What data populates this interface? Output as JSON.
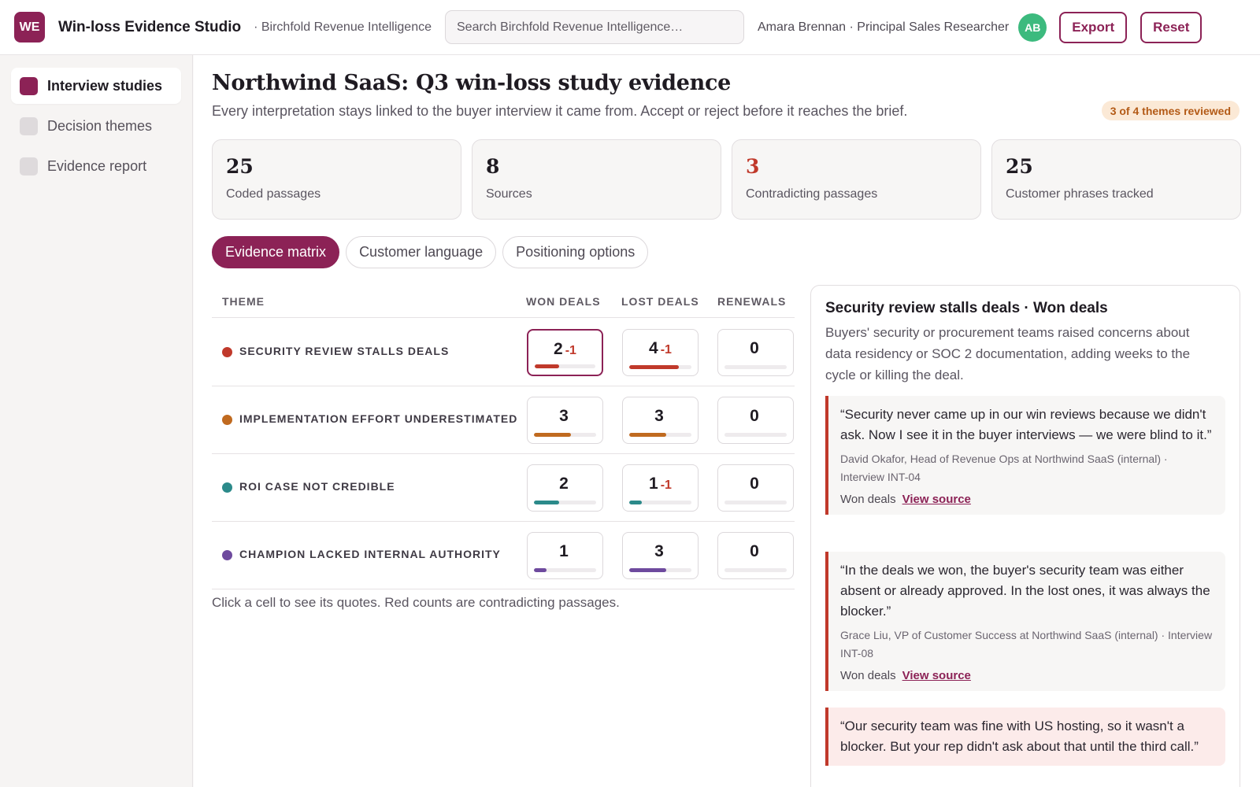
{
  "app": {
    "logo_text": "WE",
    "title": "Win-loss Evidence Studio",
    "org": "· Birchfold Revenue Intelligence",
    "search_placeholder": "Search Birchfold Revenue Intelligence…",
    "user": "Amara Brennan · Principal Sales Researcher",
    "avatar_initials": "AB",
    "export_label": "Export",
    "reset_label": "Reset",
    "accent_color": "#8c2256"
  },
  "sidebar": {
    "items": [
      {
        "label": "Interview studies",
        "active": true
      },
      {
        "label": "Decision themes",
        "active": false
      },
      {
        "label": "Evidence report",
        "active": false
      }
    ]
  },
  "page": {
    "title": "Northwind SaaS: Q3 win-loss study evidence",
    "subtitle": "Every interpretation stays linked to the buyer interview it came from. Accept or reject before it reaches the brief.",
    "review_badge": "3 of 4 themes reviewed"
  },
  "stats": [
    {
      "value": "25",
      "label": "Coded passages"
    },
    {
      "value": "8",
      "label": "Sources"
    },
    {
      "value": "3",
      "label": "Contradicting passages",
      "alert": true
    },
    {
      "value": "25",
      "label": "Customer phrases tracked"
    }
  ],
  "tabs": [
    {
      "label": "Evidence matrix",
      "active": true
    },
    {
      "label": "Customer language",
      "active": false
    },
    {
      "label": "Positioning options",
      "active": false
    }
  ],
  "matrix": {
    "headers": [
      "THEME",
      "WON DEALS",
      "LOST DEALS",
      "RENEWALS"
    ],
    "bar_max": 5,
    "rows": [
      {
        "theme": "SECURITY REVIEW STALLS DEALS",
        "color": "#c0392b",
        "cells": [
          {
            "count": "2",
            "delta": "-1",
            "bar": 2,
            "selected": true
          },
          {
            "count": "4",
            "delta": "-1",
            "bar": 4
          },
          {
            "count": "0",
            "delta": "",
            "bar": 0
          }
        ]
      },
      {
        "theme": "IMPLEMENTATION EFFORT UNDERESTIMATED",
        "color": "#c06a1f",
        "cells": [
          {
            "count": "3",
            "delta": "",
            "bar": 3
          },
          {
            "count": "3",
            "delta": "",
            "bar": 3
          },
          {
            "count": "0",
            "delta": "",
            "bar": 0
          }
        ]
      },
      {
        "theme": "ROI CASE NOT CREDIBLE",
        "color": "#2b8a8a",
        "cells": [
          {
            "count": "2",
            "delta": "",
            "bar": 2
          },
          {
            "count": "1",
            "delta": "-1",
            "bar": 1
          },
          {
            "count": "0",
            "delta": "",
            "bar": 0
          }
        ]
      },
      {
        "theme": "CHAMPION LACKED INTERNAL AUTHORITY",
        "color": "#6e4a9e",
        "cells": [
          {
            "count": "1",
            "delta": "",
            "bar": 1
          },
          {
            "count": "3",
            "delta": "",
            "bar": 3
          },
          {
            "count": "0",
            "delta": "",
            "bar": 0
          }
        ]
      }
    ],
    "note": "Click a cell to see its quotes. Red counts are contradicting passages."
  },
  "detail": {
    "title": "Security review stalls deals · Won deals",
    "description": "Buyers' security or procurement teams raised concerns about data residency or SOC 2 documentation, adding weeks to the cycle or killing the deal.",
    "quotes": [
      {
        "text": "“Security never came up in our win reviews because we didn't ask. Now I see it in the buyer interviews — we were blind to it.”",
        "attribution": "David Okafor, Head of Revenue Ops at Northwind SaaS (internal) · Interview INT-04",
        "tag": "Won deals",
        "link": "View source",
        "highlight": false
      },
      {
        "text": "“In the deals we won, the buyer's security team was either absent or already approved. In the lost ones, it was always the blocker.”",
        "attribution": "Grace Liu, VP of Customer Success at Northwind SaaS (internal) · Interview INT-08",
        "tag": "Won deals",
        "link": "View source",
        "highlight": false
      },
      {
        "text": "“Our security team was fine with US hosting, so it wasn't a blocker. But your rep didn't ask about that until the third call.”",
        "attribution": "",
        "tag": "",
        "link": "",
        "highlight": true
      }
    ]
  }
}
